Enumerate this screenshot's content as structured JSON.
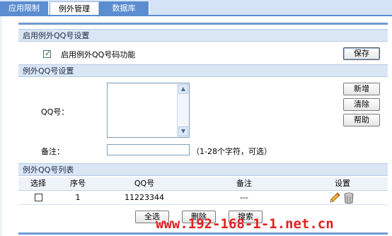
{
  "tabs": [
    {
      "label": "应用限制",
      "active": false
    },
    {
      "label": "例外管理",
      "active": true
    },
    {
      "label": "数据库",
      "active": false
    }
  ],
  "enable_section": {
    "title": "启用例外QQ号设置",
    "checkbox_label": "启用例外QQ号码功能",
    "checked": true,
    "save_button": "保存"
  },
  "qq_section": {
    "title": "例外QQ号设置",
    "qq_label": "QQ号：",
    "qq_value": "",
    "note_label": "备注：",
    "note_value": "",
    "note_hint": "（1-28个字符，可选）",
    "buttons": {
      "add": "新增",
      "clear": "清除",
      "help": "帮助"
    }
  },
  "list_section": {
    "title": "例外QQ号列表",
    "columns": [
      "选择",
      "序号",
      "QQ号",
      "备注",
      "设置"
    ],
    "rows": [
      {
        "selected": false,
        "index": "1",
        "qq": "11223344",
        "note": "---"
      }
    ]
  },
  "footer_buttons": {
    "select_all": "全选",
    "delete": "删除",
    "search": "搜索"
  },
  "watermark": "www.192-168-1-1.net.cn",
  "colors": {
    "tab_active_bg": "#ffffff",
    "tab_inactive_bg": "#5b8dd0",
    "section_bg": "#dbe6f4",
    "watermark": "#e02020"
  },
  "icons": {
    "edit": "pencil-icon",
    "delete": "trash-icon",
    "scroll_up": "arrow-up-icon",
    "scroll_down": "arrow-down-icon"
  }
}
